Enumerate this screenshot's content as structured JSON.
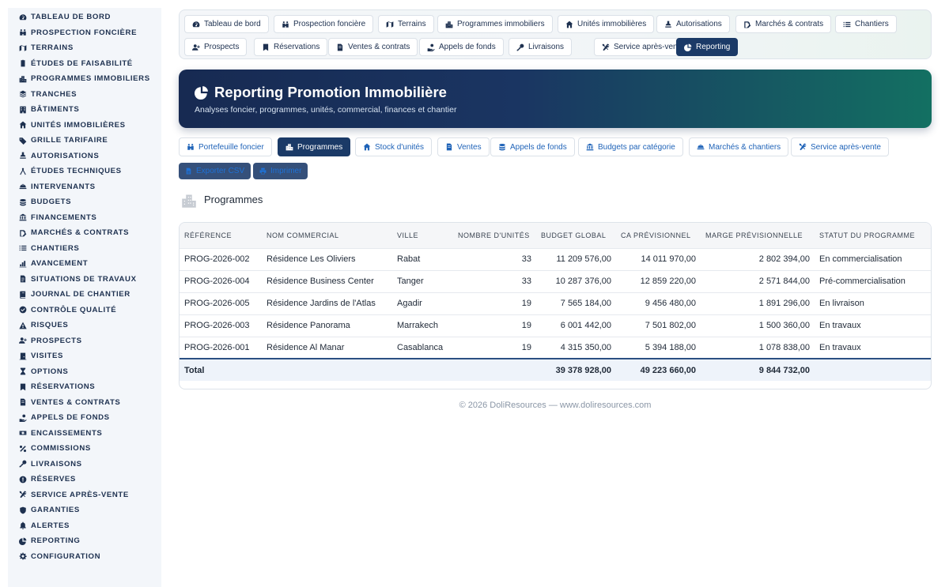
{
  "sidebar": {
    "items": [
      {
        "label": "Tableau de bord",
        "icon": "dashboard-icon"
      },
      {
        "label": "Prospection foncière",
        "icon": "binoculars-icon"
      },
      {
        "label": "Terrains",
        "icon": "map-icon"
      },
      {
        "label": "Études de faisabilité",
        "icon": "clipboard-icon"
      },
      {
        "label": "Programmes immobiliers",
        "icon": "city-icon"
      },
      {
        "label": "Tranches",
        "icon": "layers-icon"
      },
      {
        "label": "Bâtiments",
        "icon": "building-icon"
      },
      {
        "label": "Unités immobilières",
        "icon": "home-icon"
      },
      {
        "label": "Grille tarifaire",
        "icon": "tags-icon"
      },
      {
        "label": "Autorisations",
        "icon": "stamp-icon"
      },
      {
        "label": "Études techniques",
        "icon": "drafting-icon"
      },
      {
        "label": "Intervenants",
        "icon": "hardhat-icon"
      },
      {
        "label": "Budgets",
        "icon": "coins-icon"
      },
      {
        "label": "Financements",
        "icon": "bank-icon"
      },
      {
        "label": "Marchés & contrats",
        "icon": "signature-icon"
      },
      {
        "label": "Chantiers",
        "icon": "list-icon"
      },
      {
        "label": "Avancement",
        "icon": "chart-icon"
      },
      {
        "label": "Situations de travaux",
        "icon": "invoice-icon"
      },
      {
        "label": "Journal de chantier",
        "icon": "book-icon"
      },
      {
        "label": "Contrôle qualité",
        "icon": "check-circle-icon"
      },
      {
        "label": "Risques",
        "icon": "warning-icon"
      },
      {
        "label": "Prospects",
        "icon": "user-plus-icon"
      },
      {
        "label": "Visites",
        "icon": "door-icon"
      },
      {
        "label": "Options",
        "icon": "hourglass-icon"
      },
      {
        "label": "Réservations",
        "icon": "bookmark-icon"
      },
      {
        "label": "Ventes & contrats",
        "icon": "file-contract-icon"
      },
      {
        "label": "Appels de fonds",
        "icon": "hand-coin-icon"
      },
      {
        "label": "Encaissements",
        "icon": "money-icon"
      },
      {
        "label": "Commissions",
        "icon": "percent-icon"
      },
      {
        "label": "Livraisons",
        "icon": "key-icon"
      },
      {
        "label": "Réserves",
        "icon": "exclamation-icon"
      },
      {
        "label": "Service après-vente",
        "icon": "tools-icon"
      },
      {
        "label": "Garanties",
        "icon": "shield-icon"
      },
      {
        "label": "Alertes",
        "icon": "bell-icon"
      },
      {
        "label": "Reporting",
        "icon": "pie-chart-icon"
      },
      {
        "label": "Configuration",
        "icon": "gear-icon"
      }
    ]
  },
  "topnav": {
    "items": [
      {
        "label": "Tableau de bord",
        "icon": "dashboard-icon"
      },
      {
        "label": "Prospection foncière",
        "icon": "binoculars-icon"
      },
      {
        "label": "Terrains",
        "icon": "map-icon"
      },
      {
        "label": "Programmes immobiliers",
        "icon": "city-icon"
      },
      {
        "label": "Unités immobilières",
        "icon": "home-icon"
      },
      {
        "label": "Autorisations",
        "icon": "stamp-icon"
      },
      {
        "label": "Marchés & contrats",
        "icon": "signature-icon"
      },
      {
        "label": "Chantiers",
        "icon": "list-icon"
      },
      {
        "label": "Prospects",
        "icon": "user-plus-icon"
      },
      {
        "label": "Réservations",
        "icon": "bookmark-icon"
      },
      {
        "label": "Ventes & contrats",
        "icon": "file-contract-icon"
      },
      {
        "label": "Appels de fonds",
        "icon": "hand-coin-icon"
      },
      {
        "label": "Livraisons",
        "icon": "key-icon"
      },
      {
        "label": "Service après-vente",
        "icon": "tools-icon"
      },
      {
        "label": "Reporting",
        "icon": "pie-chart-icon",
        "active": true
      }
    ]
  },
  "banner": {
    "title": "Reporting Promotion Immobilière",
    "subtitle": "Analyses foncier, programmes, unités, commercial, finances et chantier"
  },
  "report_tabs": {
    "items": [
      {
        "label": "Portefeuille foncier",
        "icon": "binoculars-icon"
      },
      {
        "label": "Programmes",
        "icon": "city-icon",
        "active": true
      },
      {
        "label": "Stock d'unités",
        "icon": "home-icon"
      },
      {
        "label": "Ventes",
        "icon": "file-contract-icon"
      },
      {
        "label": "Appels de fonds",
        "icon": "coins-icon"
      },
      {
        "label": "Budgets par catégorie",
        "icon": "bank-icon"
      },
      {
        "label": "Marchés & chantiers",
        "icon": "hardhat-icon"
      },
      {
        "label": "Service après-vente",
        "icon": "tools-icon"
      }
    ]
  },
  "actions": {
    "export_label": "Exporter CSV",
    "print_label": "Imprimer"
  },
  "section": {
    "title": "Programmes",
    "icon": "city-icon"
  },
  "table": {
    "headers": [
      "Référence",
      "Nom commercial",
      "Ville",
      "Nombre d'unités",
      "Budget global",
      "CA prévisionnel",
      "Marge prévisionnelle",
      "Statut du programme"
    ],
    "rows": [
      [
        "PROG-2026-002",
        "Résidence Les Oliviers",
        "Rabat",
        "33",
        "11 209 576,00",
        "14 011 970,00",
        "2 802 394,00",
        "En commercialisation"
      ],
      [
        "PROG-2026-004",
        "Résidence Business Center",
        "Tanger",
        "33",
        "10 287 376,00",
        "12 859 220,00",
        "2 571 844,00",
        "Pré-commercialisation"
      ],
      [
        "PROG-2026-005",
        "Résidence Jardins de l'Atlas",
        "Agadir",
        "19",
        "7 565 184,00",
        "9 456 480,00",
        "1 891 296,00",
        "En livraison"
      ],
      [
        "PROG-2026-003",
        "Résidence Panorama",
        "Marrakech",
        "19",
        "6 001 442,00",
        "7 501 802,00",
        "1 500 360,00",
        "En travaux"
      ],
      [
        "PROG-2026-001",
        "Résidence Al Manar",
        "Casablanca",
        "19",
        "4 315 350,00",
        "5 394 188,00",
        "1 078 838,00",
        "En travaux"
      ]
    ],
    "total": {
      "label": "Total",
      "budget": "39 378 928,00",
      "ca": "49 223 660,00",
      "marge": "9 844 732,00"
    }
  },
  "footer": {
    "text": "© 2026 DoliResources — www.doliresources.com"
  },
  "colors": {
    "primary": "#1b3a67",
    "link": "#1f63b8",
    "banner_end": "#137062"
  }
}
